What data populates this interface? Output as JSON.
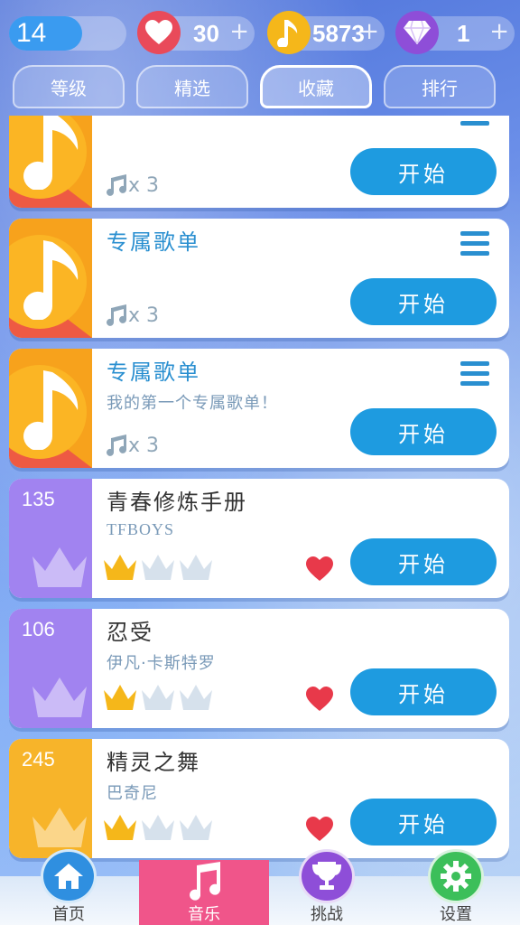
{
  "stats": {
    "level": "14",
    "level_progress": 0.62,
    "hearts": "30",
    "notes": "5873",
    "gems": "1",
    "plus": "+"
  },
  "tabs": [
    "等级",
    "精选",
    "收藏",
    "排行"
  ],
  "active_tab": 2,
  "albums": [
    {
      "title": "",
      "subtitle": "",
      "note_count": "x 3",
      "start": "开始",
      "has_menu": true
    },
    {
      "title": "专属歌单",
      "subtitle": "",
      "note_count": "x 3",
      "start": "开始",
      "has_menu": true
    },
    {
      "title": "专属歌单",
      "subtitle": "我的第一个专属歌单！",
      "note_count": "x 3",
      "start": "开始",
      "has_menu": true
    }
  ],
  "songs": [
    {
      "rank": "135",
      "title": "青春修炼手册",
      "artist": "TFBOYS",
      "crowns_earned": 1,
      "crowns_total": 3,
      "start": "开始",
      "cover": "purple"
    },
    {
      "rank": "106",
      "title": "忍受",
      "artist": "伊凡·卡斯特罗",
      "crowns_earned": 1,
      "crowns_total": 3,
      "start": "开始",
      "cover": "purple"
    },
    {
      "rank": "245",
      "title": "精灵之舞",
      "artist": "巴奇尼",
      "crowns_earned": 1,
      "crowns_total": 3,
      "start": "开始",
      "cover": "orange"
    }
  ],
  "nav": [
    {
      "label": "首页",
      "icon": "home-icon",
      "color": "#2f8fe0"
    },
    {
      "label": "音乐",
      "icon": "music-note-icon",
      "color": "#f0558a"
    },
    {
      "label": "挑战",
      "icon": "trophy-icon",
      "color": "#8e4ed8"
    },
    {
      "label": "设置",
      "icon": "gear-icon",
      "color": "#3cbf5a"
    }
  ],
  "colors": {
    "start_button": "#1e9be0",
    "crown_gold": "#f5b71a",
    "crown_grey": "#d6e1ec",
    "heart": "#e8394a"
  }
}
